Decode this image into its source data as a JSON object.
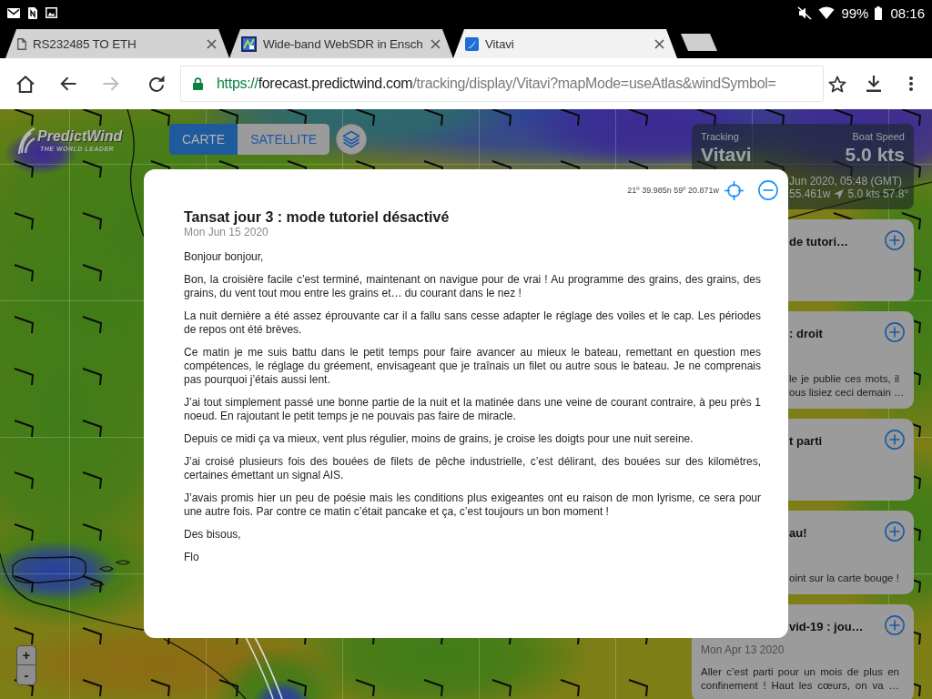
{
  "status_bar": {
    "battery": "99%",
    "time": "08:16"
  },
  "tabs": [
    {
      "kind": "document",
      "title": "RS232485 TO ETH",
      "selected": false
    },
    {
      "kind": "square_logo",
      "title": "Wide-band WebSDR in Ensch",
      "selected": false
    },
    {
      "kind": "sail_logo",
      "title": "Vitavi",
      "selected": true
    }
  ],
  "toolbar": {
    "nav_buttons": [
      {
        "kind": "home",
        "disabled": false
      },
      {
        "kind": "back",
        "disabled": false
      },
      {
        "kind": "forward",
        "disabled": true
      },
      {
        "kind": "reload",
        "disabled": false
      }
    ],
    "address": {
      "scheme": "https://",
      "host": "forecast.predictwind.com",
      "path": "/tracking/display/Vitavi?mapMode=useAtlas&windSymbol="
    }
  },
  "map": {
    "logo": {
      "name": "PredictWind",
      "tagline": "THE WORLD LEADER"
    },
    "map_modes": [
      {
        "label": "CARTE",
        "selected": true
      },
      {
        "label": "SATELLITE",
        "selected": false
      }
    ],
    "tracking": {
      "label": "Tracking",
      "boat": "Vitavi",
      "speed_label": "Boat Speed",
      "speed": "5.0 kts",
      "time": "Jun 2020, 05:48 (GMT)",
      "longitude": "55.461w",
      "course": "5.0 kts 57.8°"
    },
    "posts": [
      {
        "title": "de tutori…"
      },
      {
        "title": ": droit",
        "lines": [
          "le je publie ces mots, il",
          "ous lisiez ceci demain …"
        ]
      },
      {
        "title": "t parti"
      },
      {
        "title": "au!",
        "lines": [
          "oint sur la carte bouge !"
        ]
      },
      {
        "title": "vid-19 : jou…",
        "date": "Mon Apr 13 2020",
        "lines": [
          "Aller c’est parti pour un mois de plus en",
          "confinement ! Haut les cœurs, on va …"
        ]
      }
    ],
    "zoom_buttons": [
      "+",
      "-"
    ]
  },
  "dialog": {
    "coordinates": "21º 39.985n 59º 20.871w",
    "title": "Tansat jour 3 : mode tutoriel désactivé",
    "date": "Mon Jun 15 2020",
    "paragraphs": [
      "Bonjour bonjour,",
      "Bon, la croisière facile c’est terminé, maintenant on navigue pour de vrai ! Au programme des grains, des grains, des grains, du vent tout mou entre les grains et… du courant dans le nez !",
      "La nuit dernière a été assez éprouvante car il a fallu sans cesse adapter le réglage des voiles et le cap. Les périodes de repos ont été brèves.",
      "Ce matin je me suis battu dans le petit temps pour faire avancer au mieux le bateau, remettant en question mes compétences, le réglage du gréement, envisageant que je traînais un filet ou autre sous le bateau. Je ne comprenais pas pourquoi j’étais aussi lent.",
      "J’ai tout simplement passé une bonne partie de la nuit et la matinée dans une veine de courant contraire, à peu près 1 noeud. En rajoutant le petit temps je ne pouvais pas faire de miracle.",
      "Depuis ce midi ça va mieux, vent plus régulier, moins de grains, je croise les doigts pour une nuit sereine.",
      "J’ai croisé plusieurs fois des bouées de filets de pêche industrielle, c’est délirant, des bouées sur des kilomètres, certaines émettant un signal AIS.",
      "J’avais promis hier un peu de poésie mais les conditions plus exigeantes ont eu raison de mon lyrisme, ce sera pour une autre fois. Par contre ce matin c’était pancake et ça, c’est toujours un bon moment !",
      "Des bisous,",
      "Flo"
    ]
  }
}
